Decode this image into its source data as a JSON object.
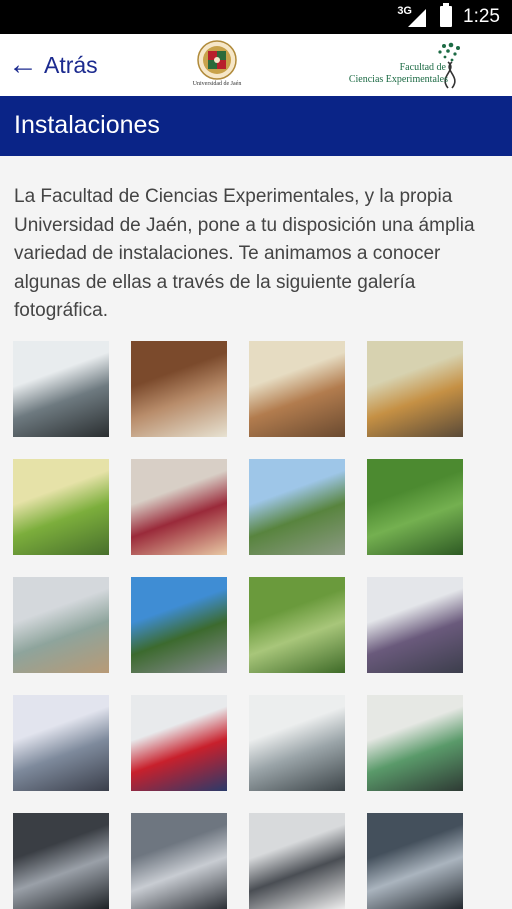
{
  "status_bar": {
    "network": "3G",
    "time": "1:25"
  },
  "header": {
    "back_label": "Atrás",
    "university_logo_text": "Universidad de Jaén",
    "faculty_logo_line1": "Facultad de",
    "faculty_logo_line2": "Ciencias Experimentales"
  },
  "page": {
    "title": "Instalaciones",
    "intro": "La Facultad de Ciencias Experimentales, y la propia Universidad de Jaén, pone a tu disposición una ámplia variedad de instalaciones. Te animamos a conocer algunas de ellas a través de la siguiente galería fotográfica."
  },
  "colors": {
    "title_bar": "#0a2487",
    "back_text": "#1b2a8f",
    "faculty_green": "#1d6b45"
  },
  "gallery": [
    {
      "name": "photo-microscope",
      "colors": [
        "#e8ecee",
        "#6e7a80",
        "#2a2e30"
      ]
    },
    {
      "name": "photo-shelves",
      "colors": [
        "#7b4a2c",
        "#b88c6a",
        "#e7e2d2"
      ]
    },
    {
      "name": "photo-library-room",
      "colors": [
        "#e6dcc2",
        "#b27c4e",
        "#6a4a30"
      ]
    },
    {
      "name": "photo-classroom-tables",
      "colors": [
        "#d7d2b0",
        "#c59044",
        "#5a4a38"
      ]
    },
    {
      "name": "photo-lab-green",
      "colors": [
        "#e6e2a8",
        "#7cae3c",
        "#486f2c"
      ]
    },
    {
      "name": "photo-auditorium",
      "colors": [
        "#d8cfc6",
        "#9a2a3a",
        "#e8c8a4"
      ]
    },
    {
      "name": "photo-pond",
      "colors": [
        "#9ec6e8",
        "#58843e",
        "#8c9a84"
      ]
    },
    {
      "name": "photo-garden",
      "colors": [
        "#4c8a30",
        "#74b050",
        "#2e5a24"
      ]
    },
    {
      "name": "photo-lab-benches",
      "colors": [
        "#d4d8dc",
        "#8ea49c",
        "#b89a76"
      ]
    },
    {
      "name": "photo-courtyard",
      "colors": [
        "#3f8dd4",
        "#3c6a2e",
        "#8a8c94"
      ]
    },
    {
      "name": "photo-park",
      "colors": [
        "#6a9a3c",
        "#a8c67a",
        "#3e6a28"
      ]
    },
    {
      "name": "photo-computer-room",
      "colors": [
        "#e4e6ea",
        "#6a5a7c",
        "#3c3e4c"
      ]
    },
    {
      "name": "photo-computer-lab",
      "colors": [
        "#e2e4ee",
        "#7e8a9c",
        "#3a3e4a"
      ]
    },
    {
      "name": "photo-researcher",
      "colors": [
        "#e8eaec",
        "#c8202c",
        "#2a3a6a"
      ]
    },
    {
      "name": "photo-equipment",
      "colors": [
        "#eceeee",
        "#9aa4a8",
        "#3c4448"
      ]
    },
    {
      "name": "photo-teaching-lab",
      "colors": [
        "#e6e8e4",
        "#5a9a6a",
        "#2e3a34"
      ]
    },
    {
      "name": "photo-partial-1",
      "colors": [
        "#3a3e44",
        "#9aa0a8",
        "#1e2226"
      ]
    },
    {
      "name": "photo-partial-2",
      "colors": [
        "#6e7680",
        "#c8ccd2",
        "#2c3036"
      ]
    },
    {
      "name": "photo-partial-3",
      "colors": [
        "#d8dadc",
        "#4a4e54",
        "#eeeeee"
      ]
    },
    {
      "name": "photo-partial-4",
      "colors": [
        "#44505c",
        "#aab4be",
        "#22282e"
      ]
    }
  ]
}
